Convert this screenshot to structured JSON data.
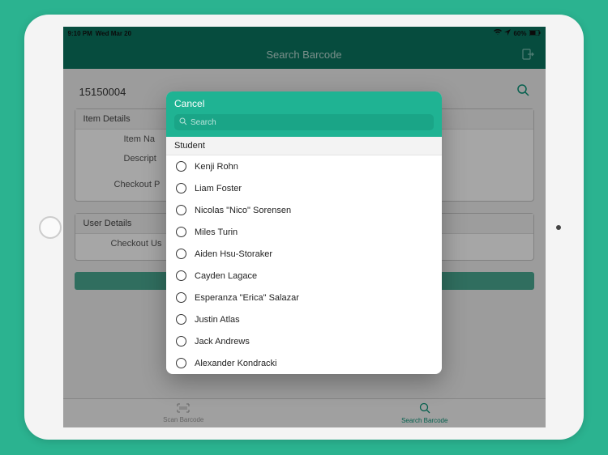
{
  "statusBar": {
    "time": "9:10 PM",
    "date": "Wed Mar 20",
    "battery": "60%"
  },
  "nav": {
    "title": "Search Barcode"
  },
  "barcode": "15150004",
  "sections": {
    "itemDetails": "Item Details",
    "itemName": "Item Na",
    "description": "Descript",
    "checkoutPr": "Checkout P",
    "userDetails": "User Details",
    "checkoutUs": "Checkout Us"
  },
  "tabs": {
    "scan": "Scan Barcode",
    "search": "Search Barcode"
  },
  "modal": {
    "cancel": "Cancel",
    "searchPlaceholder": "Search",
    "section": "Student",
    "students": [
      "Kenji Rohn",
      "Liam Foster",
      "Nicolas \"Nico\" Sorensen",
      "Miles Turin",
      "Aiden Hsu-Storaker",
      "Cayden Lagace",
      "Esperanza \"Erica\" Salazar",
      "Justin Atlas",
      "Jack Andrews",
      "Alexander Kondracki"
    ]
  }
}
